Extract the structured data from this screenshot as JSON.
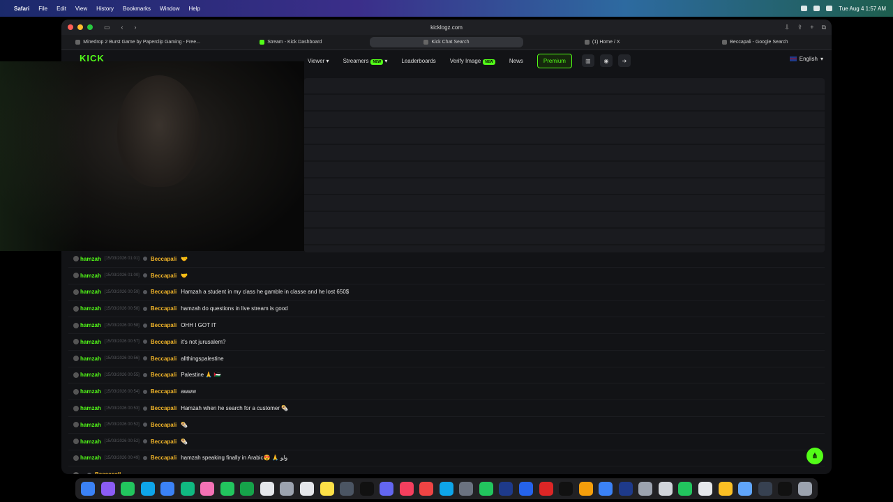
{
  "menubar": {
    "app_name": "Safari",
    "menus": [
      "File",
      "Edit",
      "View",
      "History",
      "Bookmarks",
      "Window",
      "Help"
    ],
    "datetime": "Tue Aug 4  1:57 AM"
  },
  "browser": {
    "url": "kicklogz.com",
    "tabs": [
      {
        "title": "Minedrop 2 Burst Game by Paperclip Gaming - Free...",
        "active": false
      },
      {
        "title": "Stream - Kick Dashboard",
        "active": false
      },
      {
        "title": "Kick Chat Search",
        "active": true
      },
      {
        "title": "(1) Home / X",
        "active": false
      },
      {
        "title": "Beccapali - Google Search",
        "active": false
      }
    ]
  },
  "site": {
    "logo": "KICK",
    "nav": {
      "viewer": "Viewer",
      "streamers": "Streamers",
      "streamers_badge": "NEW",
      "leaderboards": "Leaderboards",
      "verify_image": "Verify Image",
      "verify_badge": "NEW",
      "news": "News",
      "premium": "Premium"
    },
    "language": "English"
  },
  "chat": [
    {
      "user": "hamzah",
      "time": "[15/03/2026 01:01]",
      "target": "Beccapali",
      "message": "🤝"
    },
    {
      "user": "hamzah",
      "time": "[15/03/2026 01:00]",
      "target": "Beccapali",
      "message": "🤝"
    },
    {
      "user": "hamzah",
      "time": "[15/03/2026 00:59]",
      "target": "Beccapali",
      "message": "Hamzah a student in my class he gamble in classe and he lost 650$"
    },
    {
      "user": "hamzah",
      "time": "[15/03/2026 00:58]",
      "target": "Beccapali",
      "message": "hamzah do questions in live stream is good"
    },
    {
      "user": "hamzah",
      "time": "[15/03/2026 00:58]",
      "target": "Beccapali",
      "message": "OHH I GOT IT"
    },
    {
      "user": "hamzah",
      "time": "[15/03/2026 00:57]",
      "target": "Beccapali",
      "message": "it's not jurusalem?"
    },
    {
      "user": "hamzah",
      "time": "[15/03/2026 00:56]",
      "target": "Beccapali",
      "message": "allthingspalestine"
    },
    {
      "user": "hamzah",
      "time": "[15/03/2026 00:55]",
      "target": "Beccapali",
      "message": "Palestine 🙏 🇵🇸"
    },
    {
      "user": "hamzah",
      "time": "[15/03/2026 00:54]",
      "target": "Beccapali",
      "message": "awww"
    },
    {
      "user": "hamzah",
      "time": "[15/03/2026 00:53]",
      "target": "Beccapali",
      "message": "Hamzah when he search for a customer 🌯"
    },
    {
      "user": "hamzah",
      "time": "[15/03/2026 00:52]",
      "target": "Beccapali",
      "message": "🌯"
    },
    {
      "user": "hamzah",
      "time": "[15/03/2026 00:52]",
      "target": "Beccapali",
      "message": "🌯"
    },
    {
      "user": "hamzah",
      "time": "[15/03/2026 00:49]",
      "target": "Beccapali",
      "message": "hamzah speaking finally in Arabic😍 🙏 ولو"
    },
    {
      "user": "",
      "time": "",
      "target": "Beccapali",
      "message": ""
    }
  ],
  "colors": {
    "kick_green": "#53fc18",
    "target_gold": "#f0b429",
    "background": "#121316"
  },
  "icons": {
    "share_fab": "share-icon"
  }
}
